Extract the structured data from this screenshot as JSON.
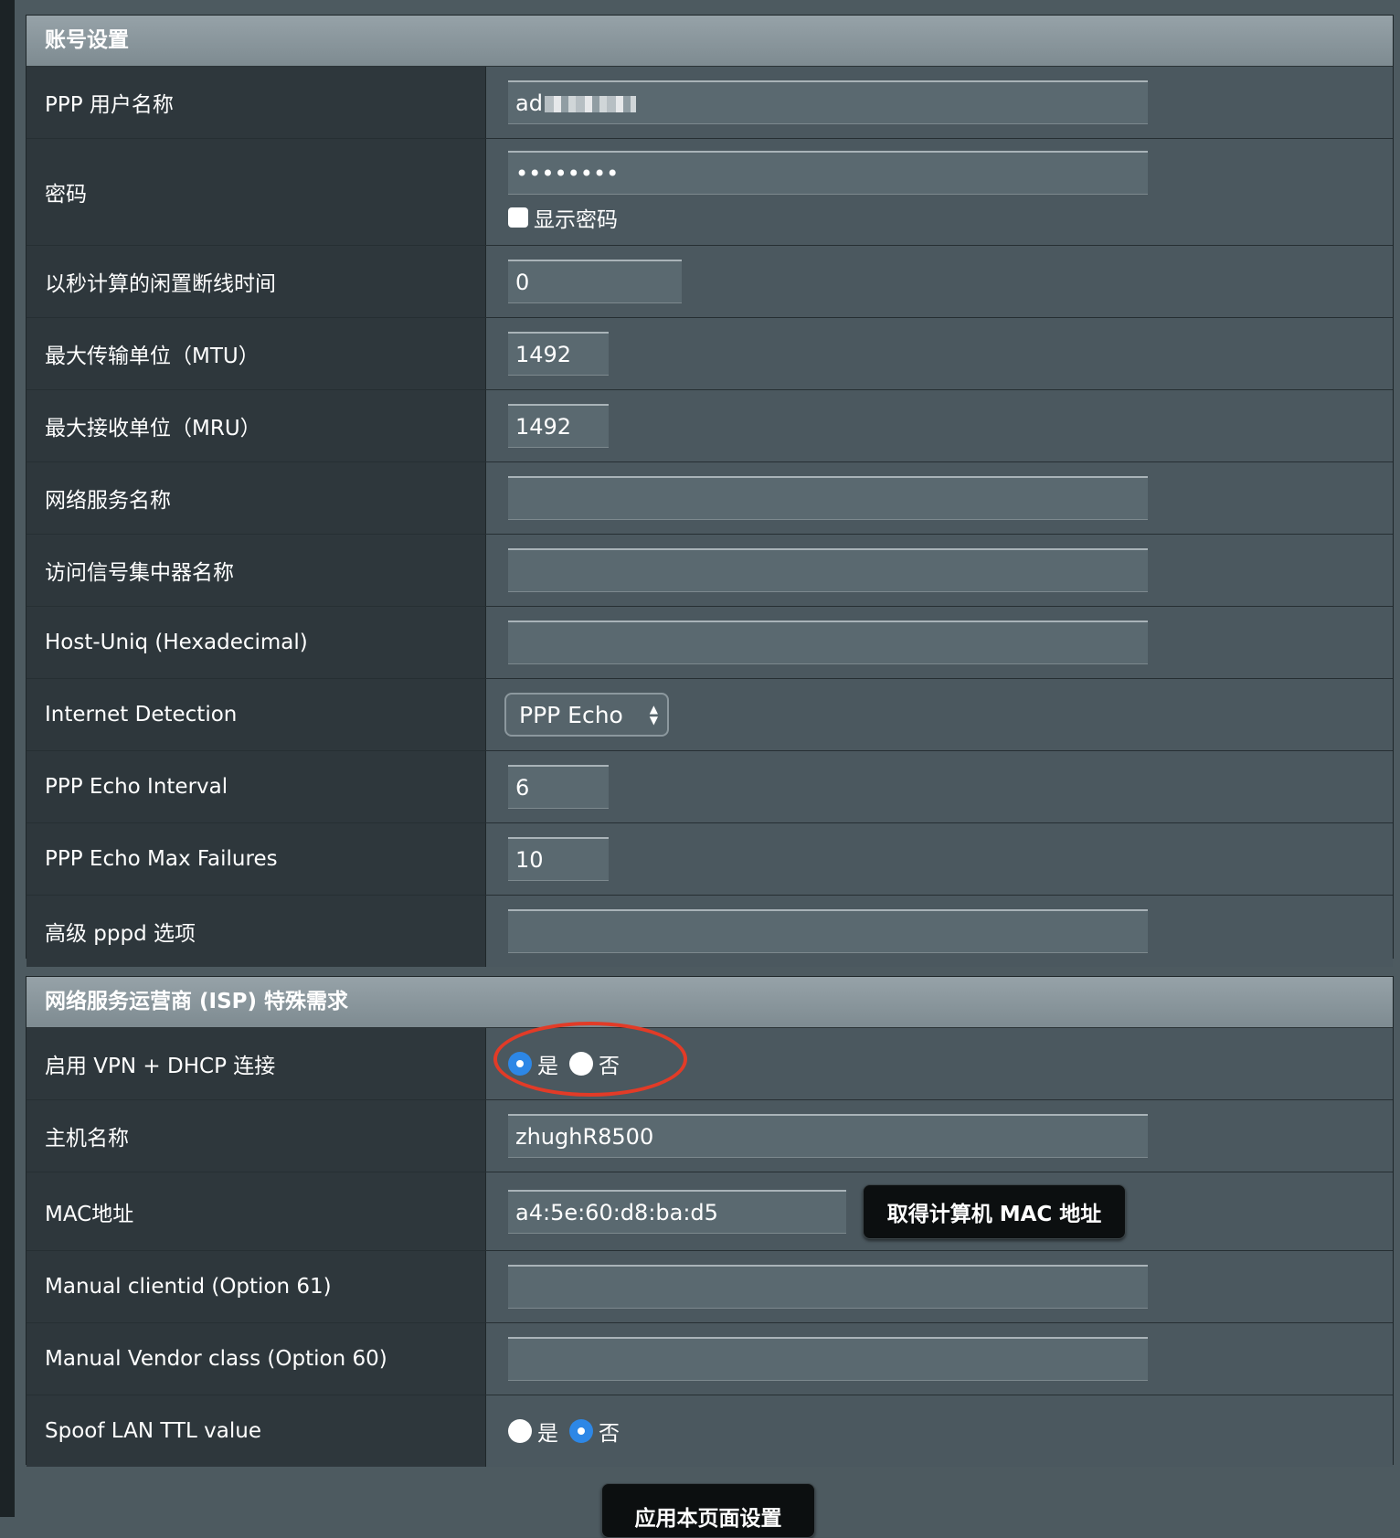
{
  "account": {
    "header": "账号设置",
    "rows": {
      "username": {
        "label": "PPP 用户名称",
        "value": "ad"
      },
      "password": {
        "label": "密码",
        "value": "••••••••",
        "show_label": "显示密码"
      },
      "idle": {
        "label": "以秒计算的闲置断线时间",
        "value": "0"
      },
      "mtu": {
        "label": "最大传输单位（MTU）",
        "value": "1492"
      },
      "mru": {
        "label": "最大接收单位（MRU）",
        "value": "1492"
      },
      "service_name": {
        "label": "网络服务名称",
        "value": ""
      },
      "ac_name": {
        "label": "访问信号集中器名称",
        "value": ""
      },
      "host_uniq": {
        "label": "Host-Uniq (Hexadecimal)",
        "value": ""
      },
      "internet_detection": {
        "label": "Internet Detection",
        "selected": "PPP Echo"
      },
      "echo_interval": {
        "label": "PPP Echo Interval",
        "value": "6"
      },
      "echo_max_failures": {
        "label": "PPP Echo Max Failures",
        "value": "10"
      },
      "pppd_options": {
        "label": "高级 pppd 选项",
        "value": ""
      }
    }
  },
  "isp": {
    "header": "网络服务运营商 (ISP) 特殊需求",
    "rows": {
      "vpn_dhcp": {
        "label": "启用 VPN + DHCP 连接",
        "yes": "是",
        "no": "否",
        "selected": "yes"
      },
      "hostname": {
        "label": "主机名称",
        "value": "zhughR8500"
      },
      "mac": {
        "label": "MAC地址",
        "value": "a4:5e:60:d8:ba:d5",
        "button": "取得计算机 MAC 地址"
      },
      "clientid": {
        "label": "Manual clientid (Option 61)",
        "value": ""
      },
      "vendor_class": {
        "label": "Manual Vendor class (Option 60)",
        "value": ""
      },
      "spoof_ttl": {
        "label": "Spoof LAN TTL value",
        "yes": "是",
        "no": "否",
        "selected": "no"
      }
    }
  },
  "apply_button": "应用本页面设置",
  "colors": {
    "accent_radio": "#2d87e6",
    "highlight": "#e23b27",
    "header_bg": "#8a969c"
  }
}
